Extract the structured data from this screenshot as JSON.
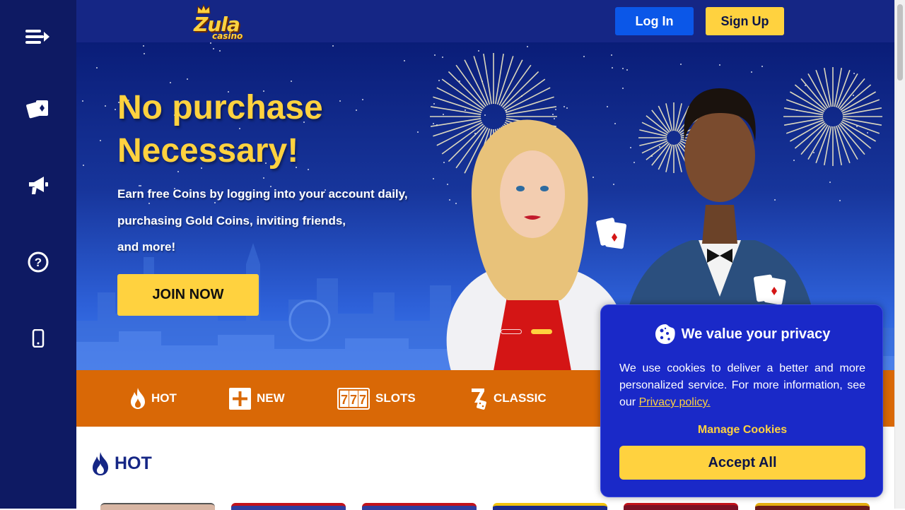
{
  "header": {
    "logo_text": "Zula",
    "logo_sub": "casino",
    "login_label": "Log In",
    "signup_label": "Sign Up"
  },
  "sidebar": {
    "items": [
      {
        "icon": "menu-icon"
      },
      {
        "icon": "cards-icon"
      },
      {
        "icon": "megaphone-icon"
      },
      {
        "icon": "help-icon"
      },
      {
        "icon": "mobile-icon"
      }
    ]
  },
  "hero": {
    "title_line1": "No purchase",
    "title_line2": "Necessary!",
    "sub_line1": "Earn free Coins by logging into your account daily,",
    "sub_line2": "purchasing Gold Coins, inviting friends,",
    "sub_line3": "and more!",
    "cta_label": "JOIN NOW",
    "active_slide": 2,
    "slide_count": 2
  },
  "categories": [
    {
      "label": "HOT",
      "icon": "flame-icon"
    },
    {
      "label": "NEW",
      "icon": "plus-box-icon"
    },
    {
      "label": "SLOTS",
      "icon": "slots-777-icon"
    },
    {
      "label": "CLASSIC",
      "icon": "seven-dice-icon"
    }
  ],
  "section": {
    "title": "HOT"
  },
  "cookie": {
    "title": "We value your privacy",
    "body_text": "We use cookies to deliver a better and more personalized service. For more information, see our ",
    "privacy_link": "Privacy policy.",
    "manage_label": "Manage Cookies",
    "accept_label": "Accept All"
  },
  "colors": {
    "sidebar": "#0e1a63",
    "header": "#152685",
    "accent_yellow": "#ffd23f",
    "login_blue": "#0b57e8",
    "category_orange": "#d96806",
    "cookie_panel": "#1a29c8"
  }
}
